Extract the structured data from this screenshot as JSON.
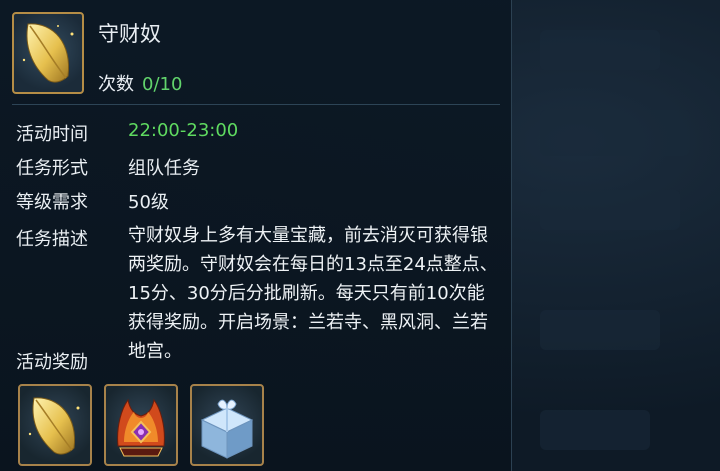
{
  "header": {
    "title": "守财奴",
    "count_label": "次数",
    "count_value": "0/10",
    "icon": "golden-leaf-icon"
  },
  "info": {
    "time_label": "活动时间",
    "time_value": "22:00-23:00",
    "form_label": "任务形式",
    "form_value": "组队任务",
    "level_label": "等级需求",
    "level_value": "50级",
    "desc_label": "任务描述",
    "desc_value": "守财奴身上多有大量宝藏，前去消灭可获得银两奖励。守财奴会在每日的13点至24点整点、15分、30分后分批刷新。每天只有前10次能获得奖励。开启场景：兰若寺、黑风洞、兰若地宫。"
  },
  "rewards": {
    "label": "活动奖励",
    "items": [
      {
        "icon": "golden-leaf-icon"
      },
      {
        "icon": "flame-crown-icon"
      },
      {
        "icon": "ice-gift-box-icon"
      }
    ]
  },
  "colors": {
    "highlight_green": "#5fda60",
    "frame_gold": "#b58d46",
    "text": "#e9eef2"
  }
}
